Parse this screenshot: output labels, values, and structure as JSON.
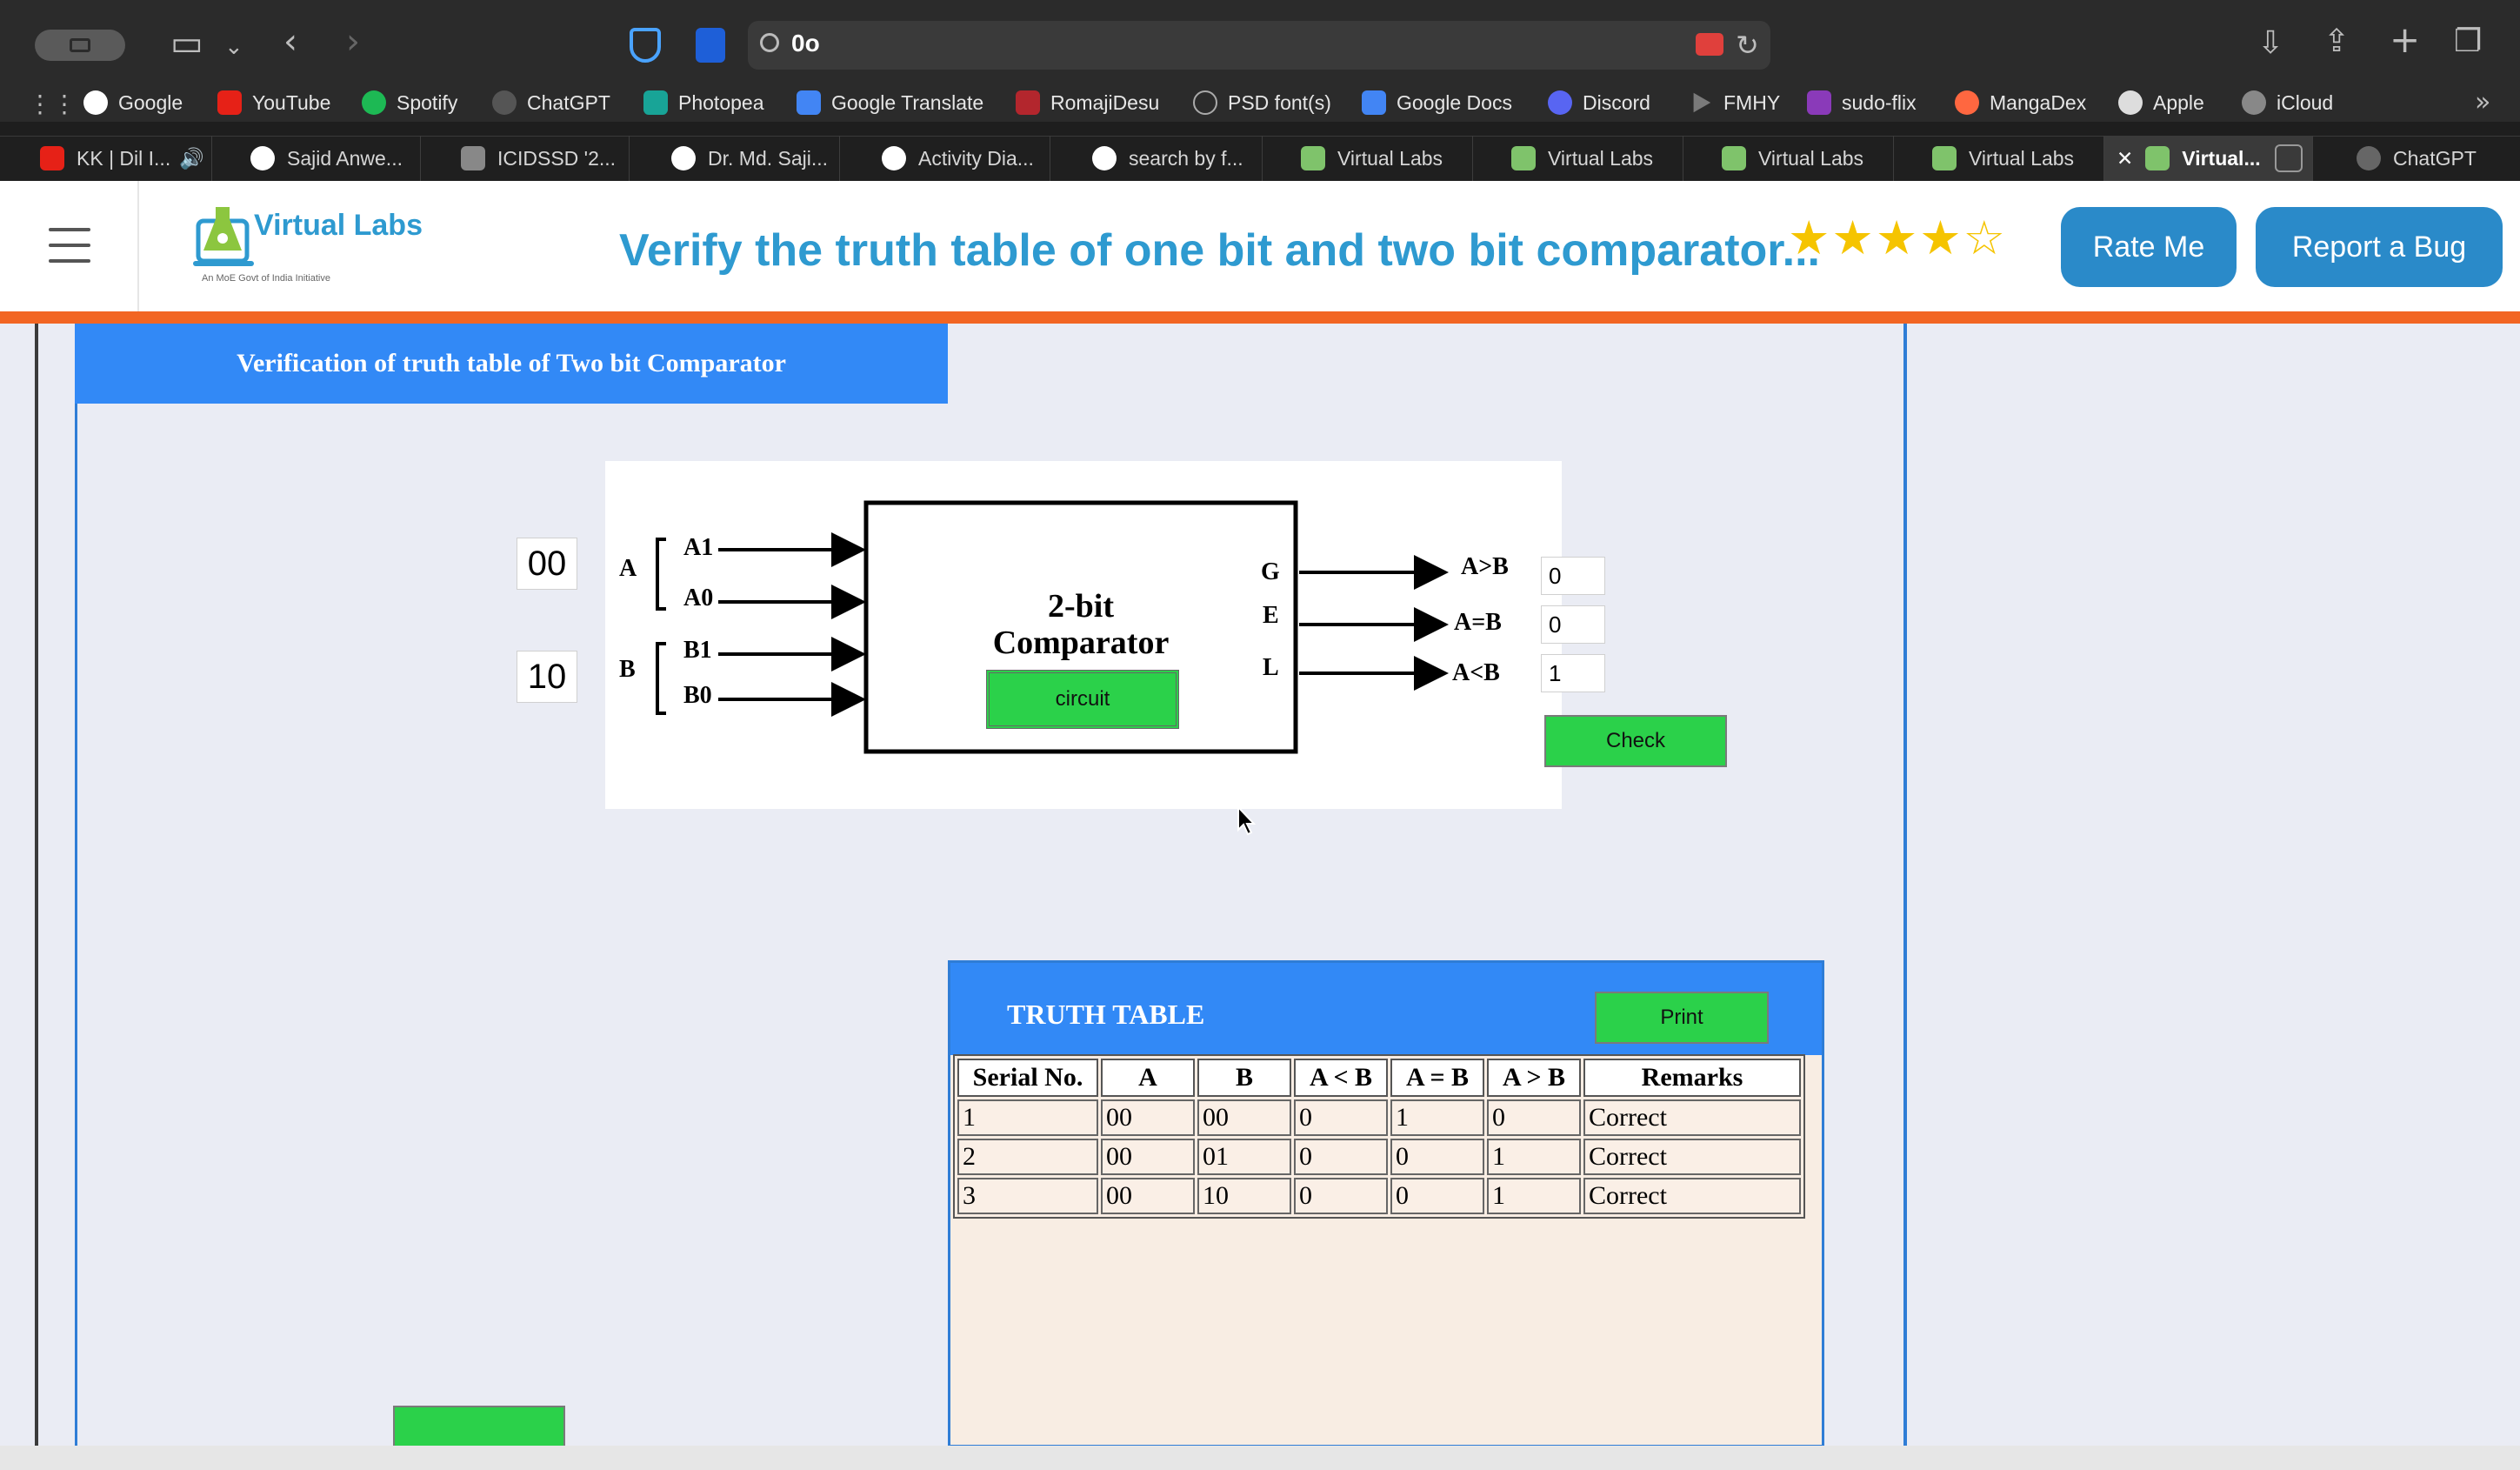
{
  "browser": {
    "url": "0o",
    "bookmarks": [
      "Google",
      "YouTube",
      "Spotify",
      "ChatGPT",
      "Photopea",
      "Google Translate",
      "RomajiDesu",
      "PSD font(s)",
      "Google Docs",
      "Discord",
      "FMHY",
      "sudo-flix",
      "MangaDex",
      "Apple",
      "iCloud"
    ],
    "tabs": [
      "KK | Dil I...",
      "Sajid Anwe...",
      "ICIDSSD '2...",
      "Dr. Md. Saji...",
      "Activity Dia...",
      "search by f...",
      "Virtual Labs",
      "Virtual Labs",
      "Virtual Labs",
      "Virtual Labs",
      "Virtual...",
      "ChatGPT"
    ]
  },
  "header": {
    "logo_text": "Virtual Labs",
    "logo_sub": "An MoE Govt of India Initiative",
    "title": "Verify the truth table of one bit and two bit comparator...",
    "stars": "★★★★☆",
    "rate_label": "Rate Me",
    "bug_label": "Report a Bug"
  },
  "panel": {
    "title": "Verification of truth table of Two bit Comparator"
  },
  "diagram": {
    "input_a": "00",
    "input_b": "10",
    "label_a": "A",
    "label_b": "B",
    "a1": "A1",
    "a0": "A0",
    "b1": "B1",
    "b0": "B0",
    "box_line1": "2-bit",
    "box_line2": "Comparator",
    "circuit_label": "circuit",
    "g": "G",
    "e": "E",
    "l": "L",
    "out_gt_label": "A>B",
    "out_eq_label": "A=B",
    "out_lt_label": "A<B",
    "out_gt": "0",
    "out_eq": "0",
    "out_lt": "1",
    "check_label": "Check"
  },
  "truth_table": {
    "title": "TRUTH TABLE",
    "print_label": "Print",
    "columns": [
      "Serial No.",
      "A",
      "B",
      "A < B",
      "A = B",
      "A > B",
      "Remarks"
    ],
    "rows": [
      [
        "1",
        "00",
        "00",
        "0",
        "1",
        "0",
        "Correct"
      ],
      [
        "2",
        "00",
        "01",
        "0",
        "0",
        "1",
        "Correct"
      ],
      [
        "3",
        "00",
        "10",
        "0",
        "0",
        "1",
        "Correct"
      ]
    ]
  },
  "colors": {
    "panel_blue": "#3289f6",
    "button_green": "#2bd14a",
    "header_blue": "#2a8ac9",
    "accent_orange": "#f26522"
  }
}
